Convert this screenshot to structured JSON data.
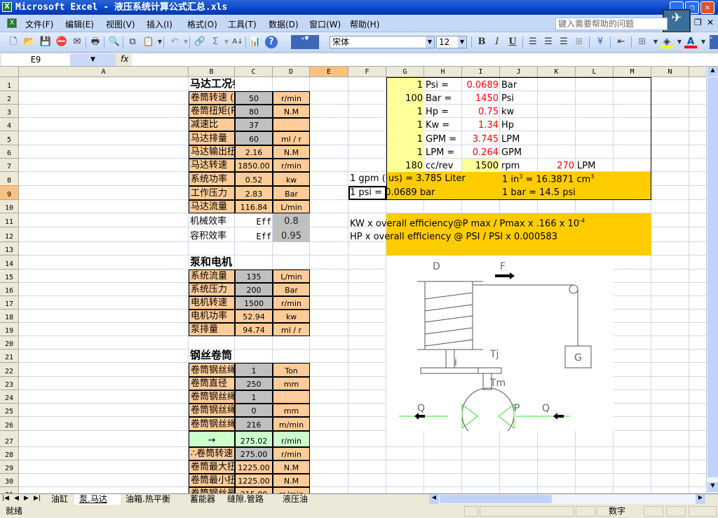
{
  "window": {
    "title": "Microsoft Excel - 液压系统计算公式汇总.xls"
  },
  "menu": [
    "文件(F)",
    "编辑(E)",
    "视图(V)",
    "插入(I)",
    "格式(O)",
    "工具(T)",
    "数据(D)",
    "窗口(W)",
    "帮助(H)"
  ],
  "help_placeholder": "键入需要帮助的问题",
  "toolbar": {
    "font": "宋体",
    "font_size": "12",
    "bold": "B",
    "italic": "I",
    "underline": "U",
    "sum": "Σ",
    "font_color": "#ff0000",
    "fill_color": "#ffff00"
  },
  "formula_bar": {
    "name_box": "E9",
    "fx": "fx",
    "formula": ""
  },
  "columns": [
    "A",
    "B",
    "C",
    "D",
    "E",
    "F",
    "G",
    "H",
    "I",
    "J",
    "K",
    "L",
    "M",
    "N"
  ],
  "selected_cell": "E9",
  "rows": [
    {
      "n": "1",
      "a": "马达工况参数",
      "section": true
    },
    {
      "n": "2",
      "a": "卷筒转速 (Required)",
      "b": "50",
      "c": "r/min",
      "input": true
    },
    {
      "n": "3",
      "a": "卷筒扭矩(Required)",
      "b": "80",
      "c": "N.M",
      "input": true
    },
    {
      "n": "4",
      "a": "减速比",
      "b": "37",
      "c": "",
      "input": true
    },
    {
      "n": "5",
      "a": "马达排量",
      "b": "60",
      "c": "ml / r",
      "input": true
    },
    {
      "n": "6",
      "a": "马达输出扭矩",
      "b": "2.16",
      "c": "N.M"
    },
    {
      "n": "7",
      "a": "马达转速",
      "b": "1850.00",
      "c": "r/min"
    },
    {
      "n": "8",
      "a": "系统功率",
      "b": "0.52",
      "c": "kw"
    },
    {
      "n": "9",
      "a": "工作压力",
      "b": "2.83",
      "c": "Bar"
    },
    {
      "n": "10",
      "a": "马达流量",
      "b": "116.84",
      "c": "L/min"
    },
    {
      "n": "11",
      "a": "机械效率",
      "b": "Eff",
      "c": "0.8",
      "eff": true
    },
    {
      "n": "12",
      "a": "容积效率",
      "b": "Eff",
      "c": "0.95",
      "eff": true
    },
    {
      "n": "13",
      "a": "",
      "blank": true
    },
    {
      "n": "14",
      "a": "泵和电机",
      "section": true
    },
    {
      "n": "15",
      "a": "系统流量",
      "b": "135",
      "c": "L/min",
      "input": true
    },
    {
      "n": "16",
      "a": "系统压力",
      "b": "200",
      "c": "Bar",
      "input": true
    },
    {
      "n": "17",
      "a": "电机转速",
      "b": "1500",
      "c": "r/min",
      "input": true
    },
    {
      "n": "18",
      "a": "电机功率",
      "b": "52.94",
      "c": "kw"
    },
    {
      "n": "19",
      "a": "泵排量",
      "b": "94.74",
      "c": "ml / r"
    },
    {
      "n": "20",
      "a": "",
      "blank": true
    },
    {
      "n": "21",
      "a": "钢丝卷筒",
      "section": true
    },
    {
      "n": "22",
      "a": "卷筒钢丝绳拉力",
      "b": "1",
      "c": "Ton",
      "input": true
    },
    {
      "n": "23",
      "a": "卷筒直径",
      "b": "250",
      "c": "mm",
      "input": true
    },
    {
      "n": "24",
      "a": "卷筒钢丝绳层数",
      "b": "1",
      "c": "",
      "input": true
    },
    {
      "n": "25",
      "a": "卷筒钢丝绳直径",
      "b": "0",
      "c": "mm",
      "input": true
    },
    {
      "n": "26",
      "a": "卷筒钢丝绳速（第一层钢丝）",
      "b": "216",
      "c": "m/min",
      "input": true
    },
    {
      "n": "27",
      "a": "→",
      "b": "275.02",
      "c": "r/min",
      "green": true
    },
    {
      "n": "28",
      "a": "∴卷筒转速",
      "b": "275.00",
      "c": "r/min",
      "input": true
    },
    {
      "n": "29",
      "a": "卷筒最大扭矩（最外钢丝）",
      "b": "1225.00",
      "c": "N.M"
    },
    {
      "n": "30",
      "a": "卷筒最小扭矩（第一层钢丝）",
      "b": "1225.00",
      "c": "N.M"
    },
    {
      "n": "31",
      "a": "卷筒钢丝最大绳速（最外层钢丝）",
      "b": "215.00",
      "c": "m/min"
    }
  ],
  "conversions": [
    {
      "f": "1",
      "g": "Psi =",
      "h": "0.0689",
      "i": "Bar"
    },
    {
      "f": "100",
      "g": "Bar =",
      "h": "1450",
      "i": "Psi"
    },
    {
      "f": "1",
      "g": "Hp  =",
      "h": "0.75",
      "i": "kw"
    },
    {
      "f": "1",
      "g": "Kw  =",
      "h": "1.34",
      "i": "Hp"
    },
    {
      "f": "1",
      "g": "GPM =",
      "h": "3.745",
      "i": "LPM"
    },
    {
      "f": "1",
      "g": "LPM =",
      "h": "0.264",
      "i": "GPM"
    },
    {
      "f": "180",
      "g": "cc/rev",
      "h": "1500",
      "i": "rpm",
      "j": "270",
      "k": "LPM"
    }
  ],
  "notes": {
    "gpm": "1  gpm ( us)  = 3.785 Liter",
    "in3_a": "1  in",
    "in3_b": "=  16.3871  cm",
    "psi": "1  psi  =  0.0689  bar",
    "bar": "1 bar  = 14.5 psi",
    "exp3": "3",
    "kw_formula": "KW x overall efficiency@P max / Pmax x .166 x 10",
    "kw_exp": "-4",
    "hp_formula": "HP x overall efficiency @ PSI / PSI x 0.000583"
  },
  "diagram": {
    "labels": {
      "D": "D",
      "F": "F",
      "Tj": "Tj",
      "i": "i",
      "G": "G",
      "Tm": "Tm",
      "Q": "Q",
      "P": "P"
    }
  },
  "sheets": [
    {
      "label": "油缸",
      "active": false
    },
    {
      "label": "泵.马达",
      "active": true
    },
    {
      "label": "油箱.热平衡",
      "active": false
    },
    {
      "label": "蓄能器",
      "active": false
    },
    {
      "label": "缝隙.管路",
      "active": false
    },
    {
      "label": "液压油",
      "active": false
    }
  ],
  "status": {
    "ready": "就绪",
    "num": "数字"
  }
}
